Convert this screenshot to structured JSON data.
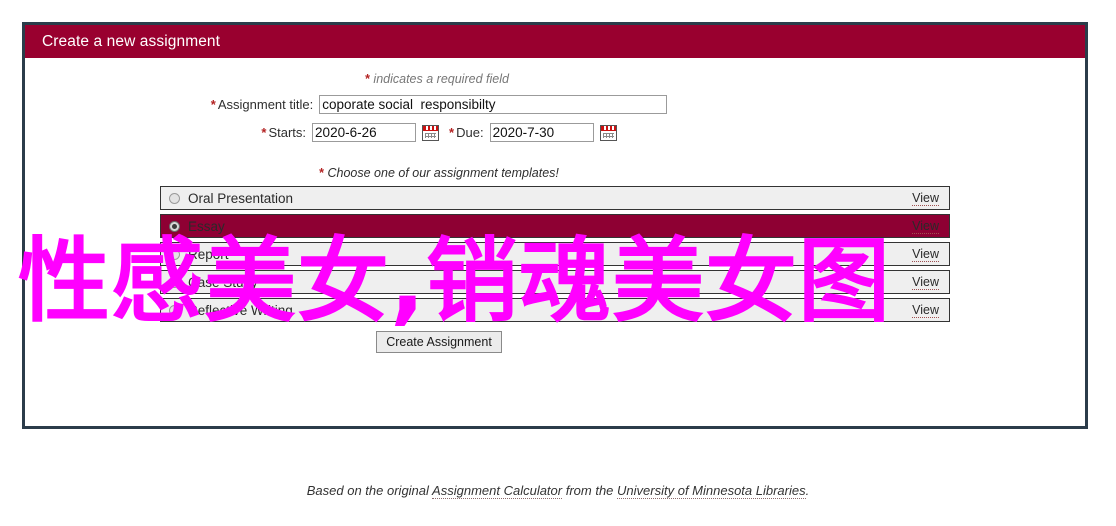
{
  "panel": {
    "header_title": "Create a new assignment",
    "header_color": "#99002f",
    "border_color": "#2b3c4a"
  },
  "form": {
    "required_note_star": "*",
    "required_note_text": "indicates a required field",
    "title_field": {
      "label_star": "*",
      "label": "Assignment title:",
      "value": "coporate social  responsibilty",
      "placeholder": ""
    },
    "starts_field": {
      "label_star": "*",
      "label": "Starts:",
      "value": "2020-6-26",
      "placeholder": "",
      "icon": "calendar-icon"
    },
    "due_field": {
      "label_star": "*",
      "label": "Due:",
      "value": "2020-7-30",
      "placeholder": "",
      "icon": "calendar-icon"
    }
  },
  "templates": {
    "note_star": "*",
    "note_text": "Choose one of our assignment templates!",
    "view_label": "View",
    "selected_index": 1,
    "items": [
      {
        "label": "Oral Presentation",
        "view": "View",
        "selected": false
      },
      {
        "label": "Essay",
        "view": "View",
        "selected": true
      },
      {
        "label": "Report",
        "view": "View",
        "selected": false
      },
      {
        "label": "Case Study",
        "view": "View",
        "selected": false
      },
      {
        "label": "Reflective Writing",
        "view": "View",
        "selected": false
      }
    ]
  },
  "submit": {
    "label": "Create Assignment"
  },
  "footer": {
    "prefix": "Based on the original ",
    "link1": "Assignment Calculator",
    "middle": " from the ",
    "link2": "University of Minnesota Libraries",
    "suffix": "."
  },
  "overlay": {
    "text": "性感美女,销魂美女图",
    "color": "#ff00ff"
  }
}
